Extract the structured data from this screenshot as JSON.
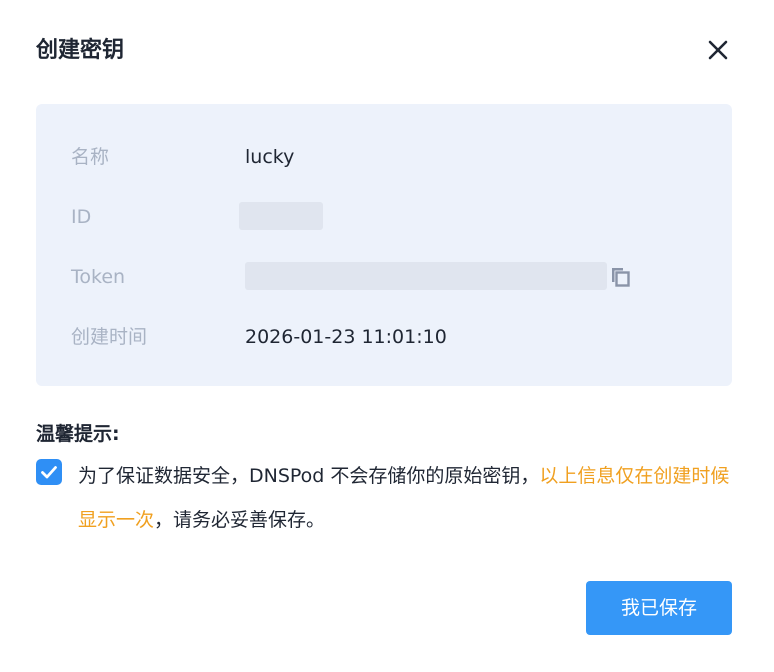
{
  "dialog": {
    "title": "创建密钥",
    "close_icon": "close-icon"
  },
  "info": {
    "name_label": "名称",
    "name_value": "lucky",
    "id_label": "ID",
    "token_label": "Token",
    "token_copy_icon": "copy-icon",
    "created_label": "创建时间",
    "created_value": "2026-01-23 11:01:10"
  },
  "tips": {
    "title": "温馨提示:",
    "checked": true,
    "text_before": "为了保证数据安全，DNSPod 不会存储你的原始密钥，",
    "text_highlight": "以上信息仅在创建时候显示一次",
    "text_after": "，请务必妥善保存。"
  },
  "actions": {
    "save_label": "我已保存"
  },
  "colors": {
    "accent": "#3597f7",
    "highlight": "#f0a020",
    "panel_bg": "#edf2fb",
    "label": "#a9b3c4",
    "text": "#1f2633"
  }
}
